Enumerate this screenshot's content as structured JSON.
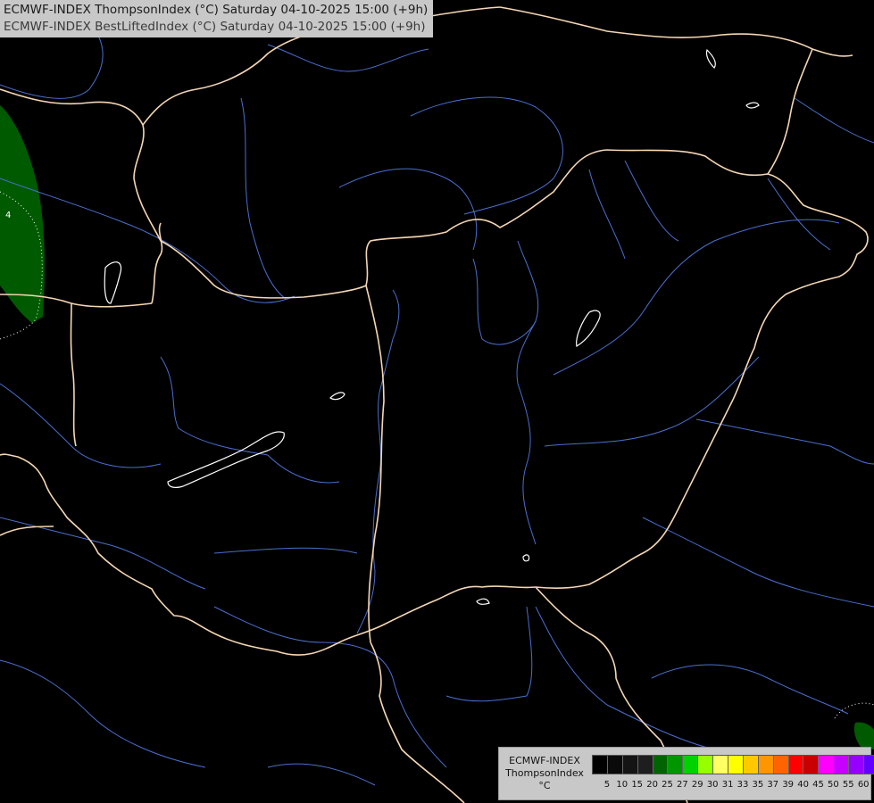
{
  "title": {
    "line1": "ECMWF-INDEX ThompsonIndex (°C) Saturday 04-10-2025 15:00 (+9h)",
    "line2": "ECMWF-INDEX BestLiftedIndex (°C) Saturday 04-10-2025 15:00 (+9h)"
  },
  "contour_label": "4",
  "legend": {
    "line1": "ECMWF-INDEX",
    "line2": "ThompsonIndex",
    "line3": "°C",
    "ticks": [
      "5",
      "10",
      "15",
      "20",
      "25",
      "27",
      "29",
      "30",
      "31",
      "33",
      "35",
      "37",
      "39",
      "40",
      "45",
      "50",
      "55",
      "60"
    ],
    "colors": [
      "#000000",
      "#0a0a0a",
      "#141414",
      "#1e1e1e",
      "#006400",
      "#009600",
      "#00d200",
      "#96ff00",
      "#ffff64",
      "#ffff00",
      "#ffc800",
      "#ff9600",
      "#ff6400",
      "#ff0000",
      "#c80000",
      "#ff00ff",
      "#c800ff",
      "#9600ff",
      "#6400ff",
      "#0000ff"
    ]
  },
  "map_colors": {
    "background": "#000000",
    "border": "#f5d7b4",
    "river": "#4a6fd0",
    "lake": "#ffffff",
    "index_region": "#005a00"
  }
}
